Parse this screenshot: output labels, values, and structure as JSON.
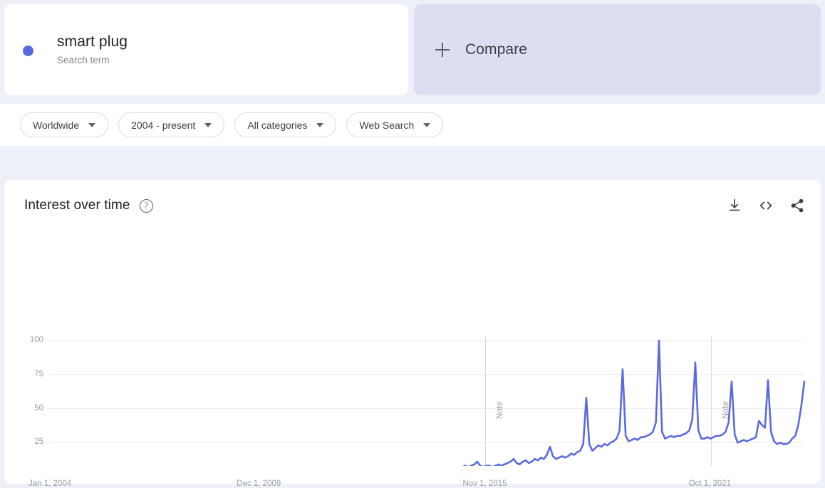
{
  "term": {
    "name": "smart plug",
    "type_label": "Search term",
    "dot_color": "#5b6ae0"
  },
  "compare": {
    "label": "Compare",
    "icon": "plus-icon",
    "bg_color": "#dcdff2"
  },
  "filters": [
    {
      "label": "Worldwide",
      "name": "location-filter"
    },
    {
      "label": "2004 - present",
      "name": "time-range-filter"
    },
    {
      "label": "All categories",
      "name": "category-filter"
    },
    {
      "label": "Web Search",
      "name": "search-type-filter"
    }
  ],
  "chart_card": {
    "title": "Interest over time",
    "help_icon": "question-mark-icon",
    "actions": [
      {
        "name": "download-icon",
        "label": "download"
      },
      {
        "name": "embed-code-icon",
        "label": "embed"
      },
      {
        "name": "share-icon",
        "label": "share"
      }
    ]
  },
  "chart_data": {
    "type": "line",
    "title": "Interest over time",
    "xlabel": "",
    "ylabel": "",
    "ylim": [
      0,
      100
    ],
    "grid": true,
    "legend_position": "top-card",
    "series_name": "smart plug",
    "series_color": "#5b6ae0",
    "annotations": [
      {
        "label": "Note",
        "x_tick": "Nov 1, 2015"
      },
      {
        "label": "Note",
        "x_tick": "Oct 1, 2021"
      }
    ],
    "y_ticks": [
      100,
      75,
      50,
      25
    ],
    "x_ticks": [
      "Jan 1, 2004",
      "Dec 1, 2009",
      "Nov 1, 2015",
      "Oct 1, 2021"
    ],
    "x_tick_positions": [
      0,
      0.2833,
      0.5806,
      0.8778
    ],
    "note_positions": [
      0.5806,
      0.8778
    ],
    "values": [
      2,
      3,
      2,
      3,
      4,
      2,
      3,
      3,
      2,
      3,
      4,
      3,
      3,
      5,
      2,
      3,
      6,
      2,
      3,
      2,
      3,
      4,
      3,
      3,
      2,
      3,
      3,
      4,
      3,
      2,
      3,
      3,
      2,
      3,
      3,
      4,
      3,
      2,
      3,
      4,
      3,
      3,
      2,
      3,
      4,
      3,
      2,
      3,
      3,
      2,
      2,
      3,
      2,
      2,
      3,
      2,
      3,
      2,
      2,
      3,
      3,
      2,
      3,
      2,
      3,
      3,
      2,
      3,
      3,
      4,
      3,
      3,
      3,
      2,
      3,
      3,
      2,
      3,
      4,
      3,
      2,
      3,
      3,
      4,
      3,
      3,
      2,
      3,
      3,
      2,
      3,
      4,
      3,
      3,
      4,
      5,
      3,
      4,
      3,
      4,
      4,
      3,
      4,
      4,
      3,
      4,
      5,
      4,
      4,
      5,
      4,
      4,
      5,
      4,
      4,
      5,
      5,
      4,
      5,
      6,
      5,
      5,
      6,
      5,
      5,
      6,
      6,
      5,
      6,
      7,
      6,
      6,
      7,
      6,
      6,
      7,
      7,
      6,
      7,
      8,
      7,
      8,
      9,
      11,
      8,
      7,
      8,
      8,
      7,
      8,
      9,
      8,
      9,
      10,
      11,
      13,
      10,
      9,
      11,
      12,
      10,
      11,
      13,
      12,
      14,
      13,
      16,
      22,
      15,
      13,
      14,
      15,
      14,
      15,
      17,
      16,
      18,
      19,
      24,
      58,
      24,
      19,
      21,
      23,
      22,
      24,
      23,
      25,
      26,
      28,
      34,
      79,
      30,
      26,
      27,
      28,
      27,
      29,
      29,
      30,
      31,
      33,
      40,
      100,
      33,
      28,
      29,
      30,
      29,
      30,
      30,
      31,
      32,
      34,
      42,
      84,
      34,
      28,
      28,
      29,
      28,
      29,
      30,
      30,
      31,
      33,
      40,
      70,
      31,
      25,
      26,
      27,
      26,
      27,
      28,
      29,
      41,
      38,
      36,
      71,
      33,
      26,
      24,
      25,
      24,
      24,
      25,
      28,
      30,
      38,
      52,
      70
    ]
  }
}
